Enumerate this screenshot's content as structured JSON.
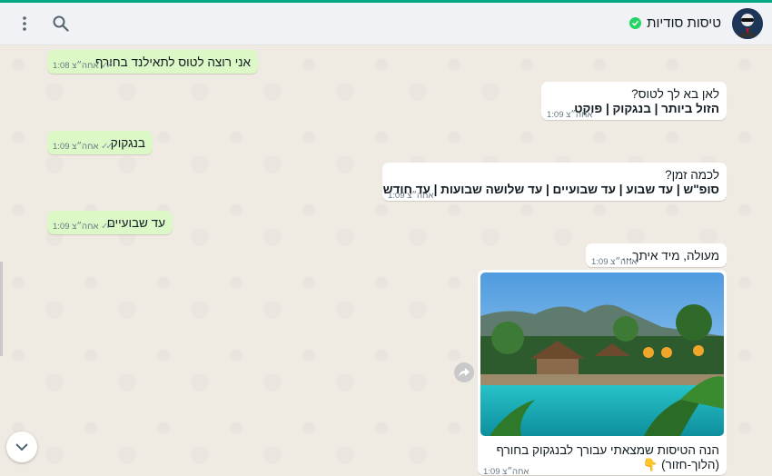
{
  "header": {
    "contact_name": "טיסות סודיות"
  },
  "messages": [
    {
      "text": "אני רוצה לטוס לתאילנד בחורף",
      "time": "1:08 אחה״צ"
    },
    {
      "line1": "לאן בא לך לטוס?",
      "line2": "הזול ביותר | בנגקוק | פוקט",
      "time": "1:09 אחה״צ"
    },
    {
      "text": "בנגקוק",
      "time": "1:09 אחה״צ"
    },
    {
      "line1": "לכמה זמן?",
      "line2": "סופ\"ש | עד שבוע | עד שבועיים | עד שלושה שבועות | עד חודש",
      "time": "1:09 אחה״צ"
    },
    {
      "text": "עד שבועיים",
      "time": "1:09 אחה״צ"
    },
    {
      "text": "מעולה, מיד איתך...",
      "time": "1:09 אחה״צ"
    },
    {
      "caption1": "הנה הטיסות שמצאתי עבורך לבנגקוק בחורף",
      "caption2": "(הלוך-חזור) 👇",
      "time": "1:09 אחה״צ"
    }
  ],
  "colors": {
    "accent": "#00a884",
    "outgoing": "#dcf8c6",
    "incoming": "#ffffff"
  }
}
